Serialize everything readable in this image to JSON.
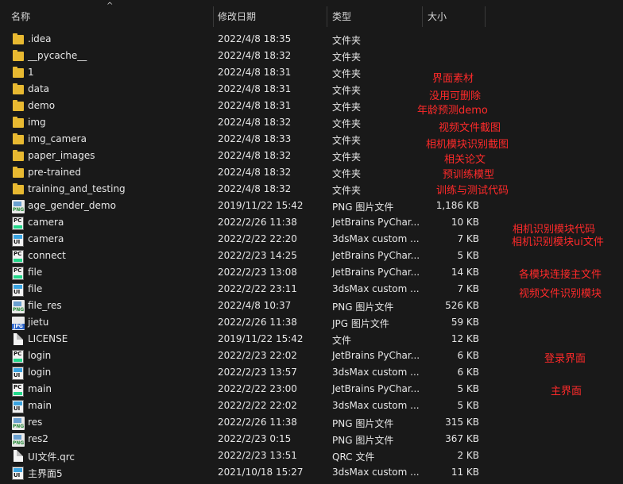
{
  "header": {
    "name": "名称",
    "date": "修改日期",
    "type": "类型",
    "size": "大小",
    "sort_caret": "^"
  },
  "files": [
    {
      "name": ".idea",
      "date": "2022/4/8 18:35",
      "type": "文件夹",
      "size": "",
      "icon": "folder"
    },
    {
      "name": "__pycache__",
      "date": "2022/4/8 18:32",
      "type": "文件夹",
      "size": "",
      "icon": "folder"
    },
    {
      "name": "1",
      "date": "2022/4/8 18:31",
      "type": "文件夹",
      "size": "",
      "icon": "folder"
    },
    {
      "name": "data",
      "date": "2022/4/8 18:31",
      "type": "文件夹",
      "size": "",
      "icon": "folder"
    },
    {
      "name": "demo",
      "date": "2022/4/8 18:31",
      "type": "文件夹",
      "size": "",
      "icon": "folder"
    },
    {
      "name": "img",
      "date": "2022/4/8 18:32",
      "type": "文件夹",
      "size": "",
      "icon": "folder"
    },
    {
      "name": "img_camera",
      "date": "2022/4/8 18:33",
      "type": "文件夹",
      "size": "",
      "icon": "folder"
    },
    {
      "name": "paper_images",
      "date": "2022/4/8 18:32",
      "type": "文件夹",
      "size": "",
      "icon": "folder"
    },
    {
      "name": "pre-trained",
      "date": "2022/4/8 18:32",
      "type": "文件夹",
      "size": "",
      "icon": "folder"
    },
    {
      "name": "training_and_testing",
      "date": "2022/4/8 18:32",
      "type": "文件夹",
      "size": "",
      "icon": "folder"
    },
    {
      "name": "age_gender_demo",
      "date": "2019/11/22 15:42",
      "type": "PNG 图片文件",
      "size": "1,186 KB",
      "icon": "png"
    },
    {
      "name": "camera",
      "date": "2022/2/26 11:38",
      "type": "JetBrains PyChar...",
      "size": "10 KB",
      "icon": "pc"
    },
    {
      "name": "camera",
      "date": "2022/2/22 22:20",
      "type": "3dsMax custom ...",
      "size": "7 KB",
      "icon": "ui"
    },
    {
      "name": "connect",
      "date": "2022/2/23 14:25",
      "type": "JetBrains PyChar...",
      "size": "5 KB",
      "icon": "pc"
    },
    {
      "name": "file",
      "date": "2022/2/23 13:08",
      "type": "JetBrains PyChar...",
      "size": "14 KB",
      "icon": "pc"
    },
    {
      "name": "file",
      "date": "2022/2/22 23:11",
      "type": "3dsMax custom ...",
      "size": "7 KB",
      "icon": "ui"
    },
    {
      "name": "file_res",
      "date": "2022/4/8 10:37",
      "type": "PNG 图片文件",
      "size": "526 KB",
      "icon": "png"
    },
    {
      "name": "jietu",
      "date": "2022/2/26 11:38",
      "type": "JPG 图片文件",
      "size": "59 KB",
      "icon": "jpg"
    },
    {
      "name": "LICENSE",
      "date": "2019/11/22 15:42",
      "type": "文件",
      "size": "12 KB",
      "icon": "doc"
    },
    {
      "name": "login",
      "date": "2022/2/23 22:02",
      "type": "JetBrains PyChar...",
      "size": "6 KB",
      "icon": "pc"
    },
    {
      "name": "login",
      "date": "2022/2/23 13:57",
      "type": "3dsMax custom ...",
      "size": "6 KB",
      "icon": "ui"
    },
    {
      "name": "main",
      "date": "2022/2/22 23:00",
      "type": "JetBrains PyChar...",
      "size": "5 KB",
      "icon": "pc"
    },
    {
      "name": "main",
      "date": "2022/2/22 22:02",
      "type": "3dsMax custom ...",
      "size": "5 KB",
      "icon": "ui"
    },
    {
      "name": "res",
      "date": "2022/2/26 11:38",
      "type": "PNG 图片文件",
      "size": "315 KB",
      "icon": "png"
    },
    {
      "name": "res2",
      "date": "2022/2/23 0:15",
      "type": "PNG 图片文件",
      "size": "367 KB",
      "icon": "png"
    },
    {
      "name": "UI文件.qrc",
      "date": "2022/2/23 13:51",
      "type": "QRC 文件",
      "size": "2 KB",
      "icon": "doc"
    },
    {
      "name": "主界面5",
      "date": "2021/10/18 15:27",
      "type": "3dsMax custom ...",
      "size": "11 KB",
      "icon": "ui"
    }
  ],
  "annotations": {
    "a1": "界面素材",
    "a2": "没用可删除",
    "a3": "年龄预测demo",
    "a4": "视频文件截图",
    "a5": "相机模块识别截图",
    "a6": "相关论文",
    "a7": "预训练模型",
    "a8": "训练与测试代码",
    "a9": "相机识别模块代码",
    "a10": "相机识别模块ui文件",
    "a11": "各模块连接主文件",
    "a12": "视频文件识别模块",
    "a13": "登录界面",
    "a14": "主界面"
  },
  "colors": {
    "annotation": "#ff2a2a",
    "folder": "#e8b931",
    "background": "#191919"
  }
}
